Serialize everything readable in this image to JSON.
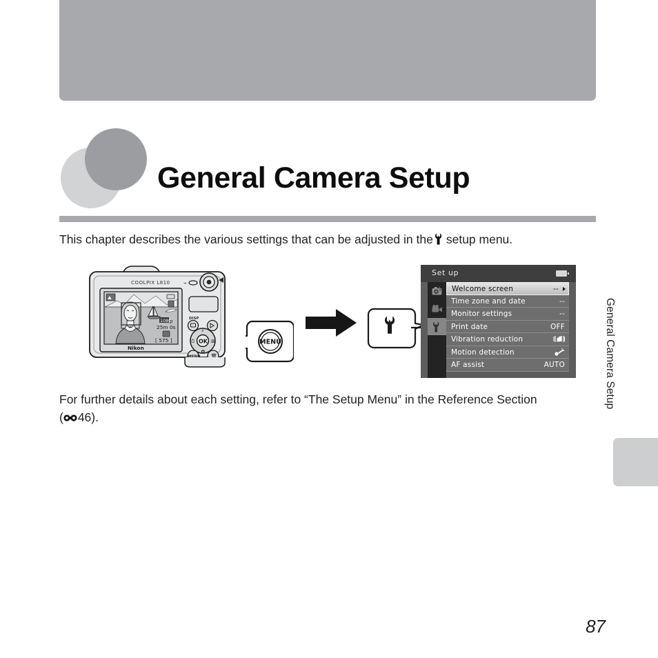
{
  "page": {
    "title": "General Camera Setup",
    "running_head": "General Camera Setup",
    "page_number": "87"
  },
  "intro": {
    "text_before": "This chapter describes the various settings that can be adjusted in the",
    "icon": "wrench-icon",
    "text_after": "setup menu."
  },
  "details": {
    "line1": "For further details about each setting, refer to “The Setup Menu” in the Reference Section",
    "open_paren": "(",
    "ref_icon": "reference-section-icon",
    "ref_page": "46",
    "close": ")."
  },
  "figure": {
    "camera_model": "COOLPIX L810",
    "camera_brand": "Nikon",
    "menu_button_label": "MENU",
    "arrow": "right-arrow",
    "wrench_callout_icon": "wrench-icon",
    "lcd": {
      "zoom_indicator": "macro-mode",
      "image_quality": "1080p",
      "record_time": "25m 0s",
      "shots_remaining": "575",
      "brand": "Nikon"
    }
  },
  "menu_screen": {
    "header_title": "Set up",
    "battery_icon": "battery-icon",
    "tabs": [
      {
        "name": "shooting-tab",
        "icon": "camera-icon",
        "selected": false
      },
      {
        "name": "movie-tab",
        "icon": "movie-camera-icon",
        "selected": false
      },
      {
        "name": "setup-tab",
        "icon": "wrench-icon",
        "selected": true
      }
    ],
    "rows": [
      {
        "label": "Welcome screen",
        "value": "--",
        "highlighted": true,
        "has_arrow": true,
        "value_icon": null
      },
      {
        "label": "Time zone and date",
        "value": "--",
        "highlighted": false,
        "has_arrow": false,
        "value_icon": null
      },
      {
        "label": "Monitor settings",
        "value": "--",
        "highlighted": false,
        "has_arrow": false,
        "value_icon": null
      },
      {
        "label": "Print date",
        "value": "OFF",
        "highlighted": false,
        "has_arrow": false,
        "value_icon": null
      },
      {
        "label": "Vibration reduction",
        "value": "",
        "highlighted": false,
        "has_arrow": false,
        "value_icon": "vibration-reduction-icon"
      },
      {
        "label": "Motion detection",
        "value": "",
        "highlighted": false,
        "has_arrow": false,
        "value_icon": "motion-detection-icon"
      },
      {
        "label": "AF assist",
        "value": "AUTO",
        "highlighted": false,
        "has_arrow": false,
        "value_icon": null
      }
    ]
  },
  "colors": {
    "banner_gray": "#a7a9ac",
    "rule_gray": "#a7a9ac",
    "circle_light": "#d2d3d4",
    "circle_dark": "#9b9da0",
    "thumb_tab": "#cdcecf",
    "menu_header": "#3e3e3e",
    "menu_row": "#6e6e6e",
    "menu_tabcol": "#232323",
    "text": "#231f20"
  }
}
